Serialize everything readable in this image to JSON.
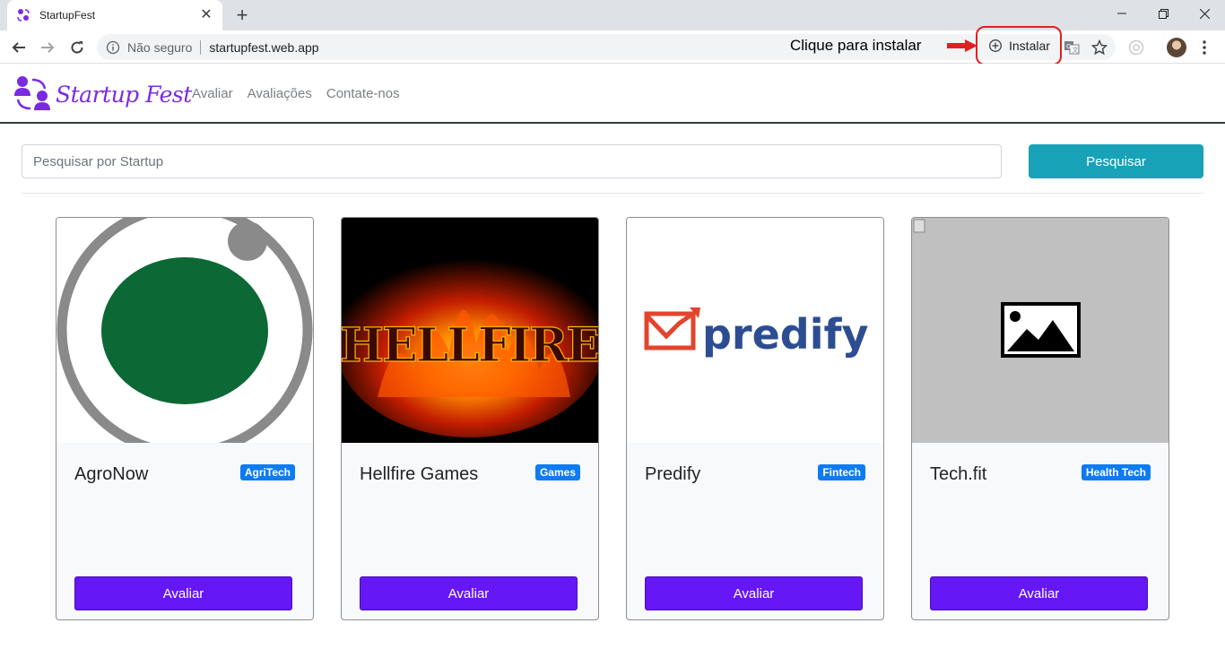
{
  "browser": {
    "tab_title": "StartupFest",
    "security_text": "Não seguro",
    "url": "startupfest.web.app",
    "install_label": "Instalar",
    "annotation": "Clique para instalar",
    "annotation_color": "#e02020"
  },
  "app": {
    "brand": "Startup Fest",
    "brand_color": "#7a2be2",
    "nav": [
      {
        "label": "Avaliar"
      },
      {
        "label": "Avaliações"
      },
      {
        "label": "Contate-nos"
      }
    ]
  },
  "search": {
    "placeholder": "Pesquisar por Startup",
    "button_label": "Pesquisar",
    "button_color": "#17a2b8"
  },
  "cards": [
    {
      "title": "AgroNow",
      "badge": "AgriTech",
      "button_label": "Avaliar",
      "image": "agronow-logo"
    },
    {
      "title": "Hellfire Games",
      "badge": "Games",
      "button_label": "Avaliar",
      "image": "hellfire-logo",
      "image_text": "HELLFIRE"
    },
    {
      "title": "Predify",
      "badge": "Fintech",
      "button_label": "Avaliar",
      "image": "predify-logo",
      "image_text": "predify"
    },
    {
      "title": "Tech.fit",
      "badge": "Health Tech",
      "button_label": "Avaliar",
      "image": "broken-image-placeholder"
    }
  ],
  "colors": {
    "badge": "#0d7bf2",
    "card_button": "#6517f5"
  }
}
